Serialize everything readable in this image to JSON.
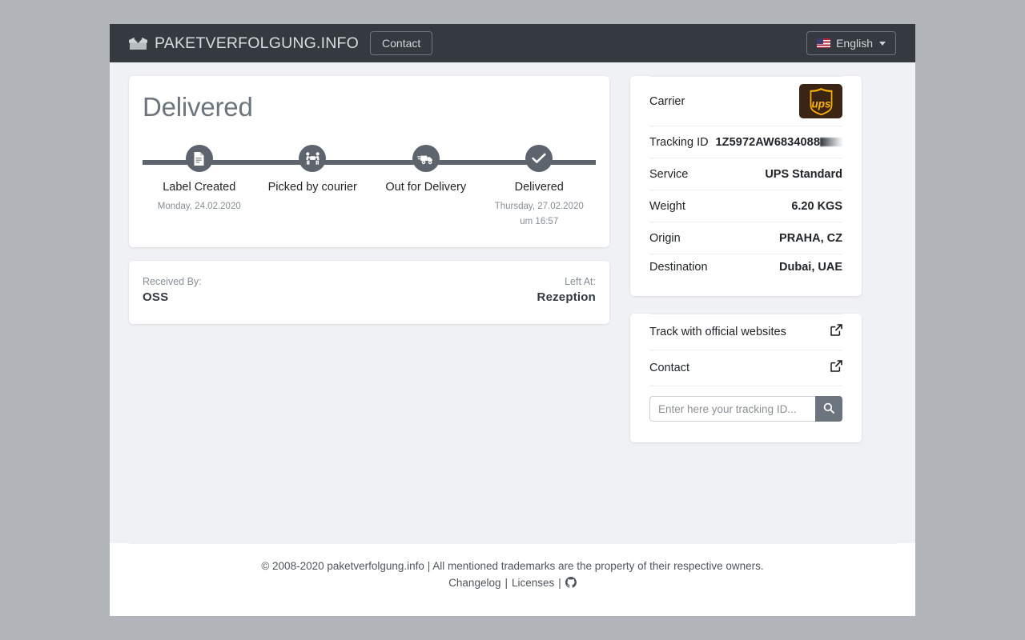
{
  "navbar": {
    "brand": "PAKETVERFOLGUNG.INFO",
    "brand_icon": "open-box-icon",
    "contact_label": "Contact",
    "language_label": "English",
    "language_flag": "us-flag-icon"
  },
  "status": {
    "title": "Delivered",
    "steps": [
      {
        "label": "Label Created",
        "icon": "document-icon",
        "date": "Monday, 24.02.2020",
        "time": ""
      },
      {
        "label": "Picked by courier",
        "icon": "handover-icon",
        "date": "",
        "time": ""
      },
      {
        "label": "Out for Delivery",
        "icon": "truck-icon",
        "date": "",
        "time": ""
      },
      {
        "label": "Delivered",
        "icon": "check-icon",
        "date": "Thursday, 27.02.2020",
        "time": "um 16:57"
      }
    ]
  },
  "received": {
    "received_by_label": "Received By:",
    "received_by_value": "OSS",
    "left_at_label": "Left At:",
    "left_at_value": "Rezeption"
  },
  "details": {
    "carrier_label": "Carrier",
    "carrier_logo": "ups-logo",
    "carrier_logo_text": "ups",
    "rows": [
      {
        "key": "Tracking ID",
        "value": "1Z5972AW6834088",
        "redacted": true
      },
      {
        "key": "Service",
        "value": "UPS Standard"
      },
      {
        "key": "Weight",
        "value": "6.20 KGS"
      },
      {
        "key": "Origin",
        "value": "PRAHA, CZ"
      },
      {
        "key": "Destination",
        "value": "Dubai, UAE"
      }
    ]
  },
  "links": {
    "items": [
      {
        "label": "Track with official websites",
        "icon": "external-link-icon"
      },
      {
        "label": "Contact",
        "icon": "external-link-icon"
      }
    ],
    "search_placeholder": "Enter here your tracking ID...",
    "search_value": "",
    "search_icon": "search-icon"
  },
  "footer": {
    "copyright": "© 2008-2020 paketverfolgung.info | All mentioned trademarks are the property of their respective owners.",
    "changelog": "Changelog",
    "separator": "|",
    "licenses": "Licenses",
    "github_icon": "github-icon"
  },
  "colors": {
    "navbar_bg": "#343a40",
    "page_bg": "#f0f1f4",
    "accent_gray": "#6c757d",
    "tracker": "#5d646d",
    "ups_brown": "#3c2415",
    "ups_gold": "#ffb500",
    "outer_bg": "#b1b5b9"
  }
}
